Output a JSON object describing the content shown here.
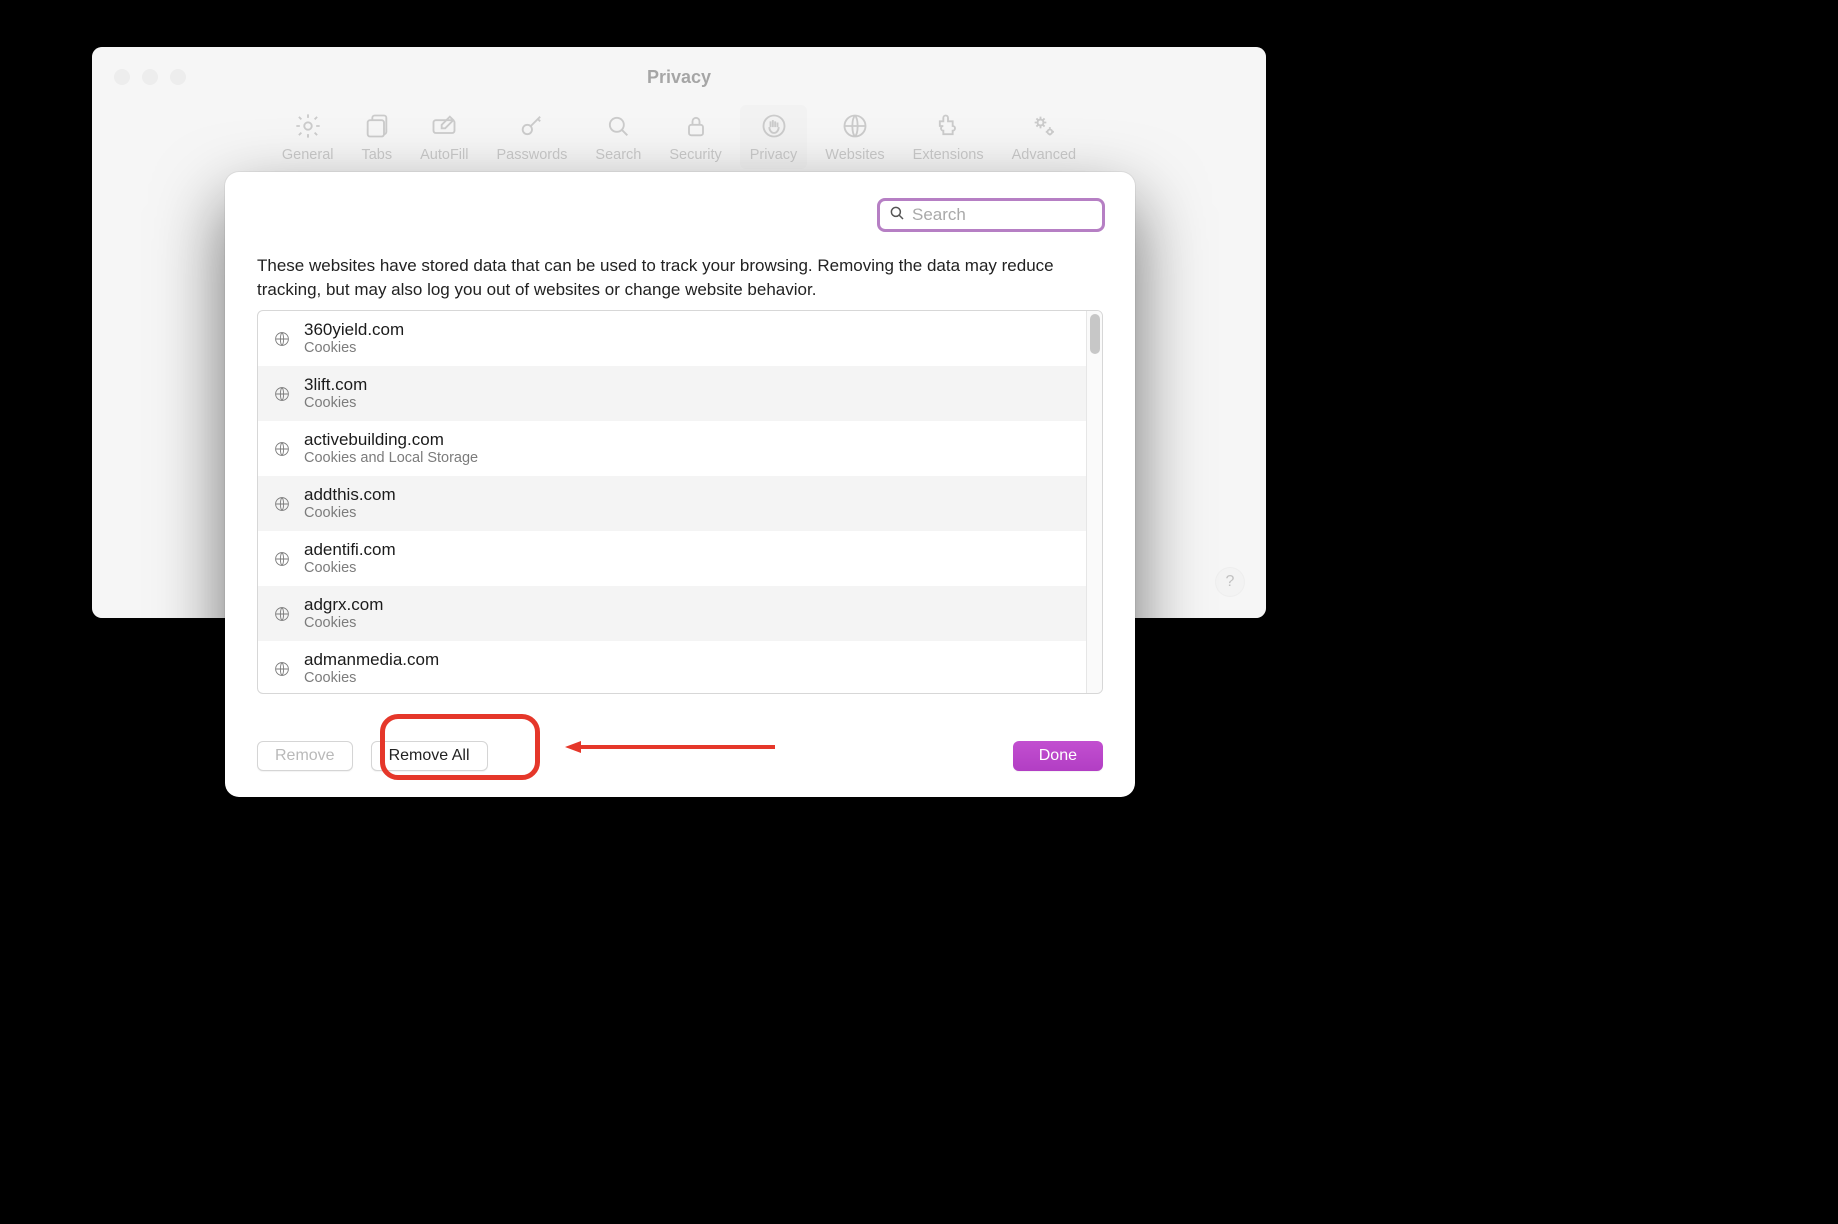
{
  "window": {
    "title": "Privacy",
    "tabs": [
      {
        "label": "General"
      },
      {
        "label": "Tabs"
      },
      {
        "label": "AutoFill"
      },
      {
        "label": "Passwords"
      },
      {
        "label": "Search"
      },
      {
        "label": "Security"
      },
      {
        "label": "Privacy"
      },
      {
        "label": "Websites"
      },
      {
        "label": "Extensions"
      },
      {
        "label": "Advanced"
      }
    ],
    "help": "?"
  },
  "sheet": {
    "search_placeholder": "Search",
    "description": "These websites have stored data that can be used to track your browsing. Removing the data may reduce tracking, but may also log you out of websites or change website behavior.",
    "sites": [
      {
        "domain": "360yield.com",
        "detail": "Cookies"
      },
      {
        "domain": "3lift.com",
        "detail": "Cookies"
      },
      {
        "domain": "activebuilding.com",
        "detail": "Cookies and Local Storage"
      },
      {
        "domain": "addthis.com",
        "detail": "Cookies"
      },
      {
        "domain": "adentifi.com",
        "detail": "Cookies"
      },
      {
        "domain": "adgrx.com",
        "detail": "Cookies"
      },
      {
        "domain": "admanmedia.com",
        "detail": "Cookies"
      }
    ],
    "buttons": {
      "remove": "Remove",
      "remove_all": "Remove All",
      "done": "Done"
    }
  }
}
